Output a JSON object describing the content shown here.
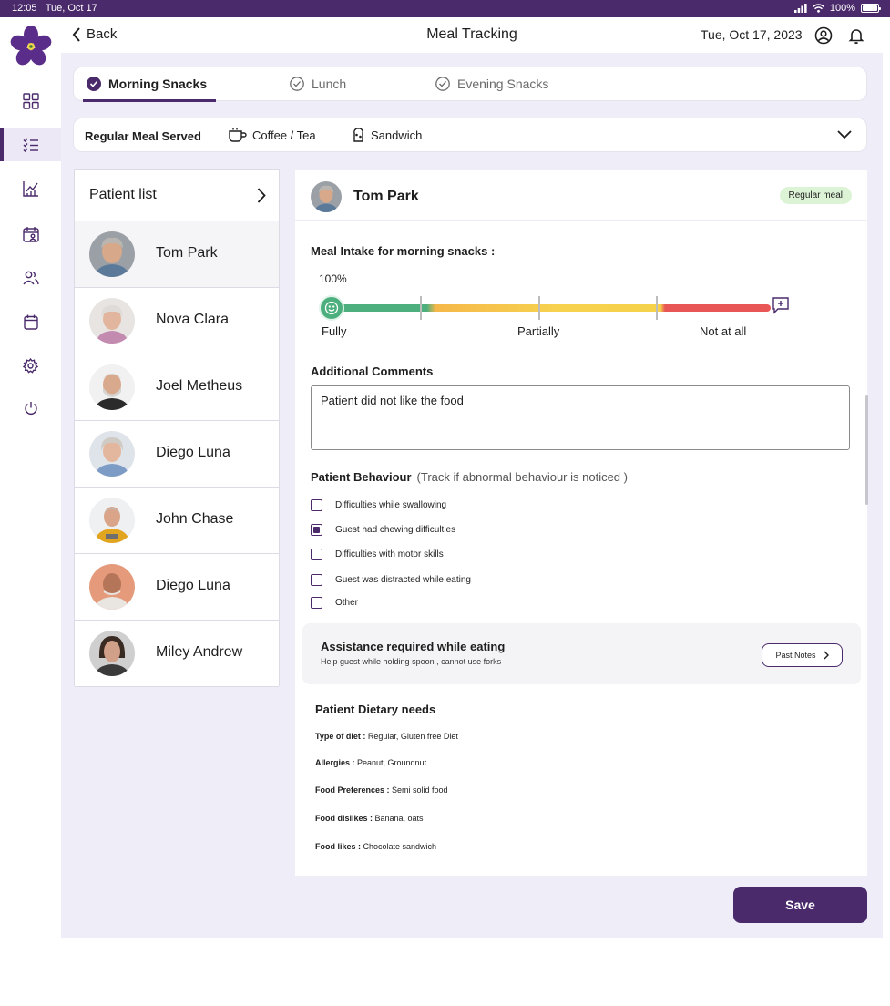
{
  "status_bar": {
    "time": "12:05",
    "date": "Tue, Oct 17",
    "battery": "100%"
  },
  "header": {
    "back_label": "Back",
    "title": "Meal Tracking",
    "date": "Tue, Oct 17, 2023"
  },
  "tabs": [
    {
      "label": "Morning Snacks",
      "active": true
    },
    {
      "label": "Lunch",
      "active": false
    },
    {
      "label": "Evening Snacks",
      "active": false
    }
  ],
  "meal_served": {
    "label": "Regular Meal Served",
    "items": [
      "Coffee / Tea",
      "Sandwich"
    ]
  },
  "patient_list": {
    "title": "Patient list",
    "patients": [
      {
        "name": "Tom Park",
        "selected": true
      },
      {
        "name": "Nova Clara",
        "selected": false
      },
      {
        "name": "Joel Metheus",
        "selected": false
      },
      {
        "name": "Diego Luna",
        "selected": false
      },
      {
        "name": "John Chase",
        "selected": false
      },
      {
        "name": "Diego Luna",
        "selected": false
      },
      {
        "name": "Miley Andrew",
        "selected": false
      }
    ]
  },
  "detail": {
    "patient_name": "Tom Park",
    "badge": "Regular meal",
    "intake_title": "Meal Intake for morning snacks :",
    "intake_percent": "100%",
    "intake_value": 1.0,
    "intake_levels": [
      "Fully",
      "Partially",
      "Not at all"
    ],
    "comments_title": "Additional Comments",
    "comment_text": "Patient did not like the food",
    "behaviour_title": "Patient Behaviour",
    "behaviour_subtitle": "(Track if abnormal behaviour is noticed )",
    "behaviours": [
      {
        "label": "Difficulties while swallowing",
        "checked": false
      },
      {
        "label": "Guest had chewing difficulties",
        "checked": true
      },
      {
        "label": "Difficulties with motor skills",
        "checked": false
      },
      {
        "label": "Guest was distracted while eating",
        "checked": false
      },
      {
        "label": "Other",
        "checked": false
      }
    ],
    "assistance": {
      "title": "Assistance required while eating",
      "subtitle": "Help guest while holding spoon , cannot use forks",
      "button": "Past Notes"
    },
    "dietary": {
      "title": "Patient Dietary needs",
      "rows": [
        {
          "key": "Type of diet :",
          "value": " Regular, Gluten free Diet"
        },
        {
          "key": "Allergies :",
          "value": " Peanut, Groundnut"
        },
        {
          "key": "Food Preferences :",
          "value": " Semi solid food"
        },
        {
          "key": "Food dislikes :",
          "value": " Banana, oats"
        },
        {
          "key": "Food likes :",
          "value": " Chocolate sandwich"
        }
      ]
    }
  },
  "save_label": "Save",
  "colors": {
    "brand": "#4a2a6b",
    "background": "#efedf8",
    "good": "#4caf7d",
    "bad": "#e85656",
    "badge": "#ddf3d6"
  },
  "icons": {
    "sidebar": [
      "dashboard-icon",
      "checklist-icon",
      "chart-icon",
      "calendar-person-icon",
      "users-icon",
      "calendar-icon",
      "settings-icon",
      "power-icon"
    ]
  }
}
